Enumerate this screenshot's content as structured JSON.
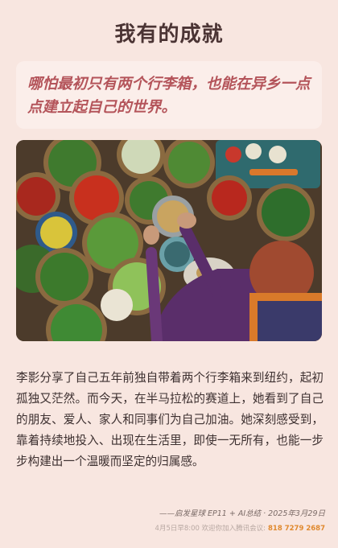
{
  "header": {
    "title": "我有的成就"
  },
  "quote": {
    "text": "哪怕最初只有两个行李箱，也能在异乡一点点建立起自己的世界。"
  },
  "photo": {
    "icon": "market-vegetables-photo"
  },
  "article": {
    "body": "李影分享了自己五年前独自带着两个行李箱来到纽约，起初孤独又茫然。而今天，在半马拉松的赛道上，她看到了自己的朋友、爱人、家人和同事们为自己加油。她深刻感受到，靠着持续地投入、出现在生活里，即使一无所有，也能一步步构建出一个温暖而坚定的归属感。"
  },
  "signature": {
    "text": "——启发星球 EP11 + AI总结 · 2025年3月29日"
  },
  "footer": {
    "notice": "4月5日早8:00 欢迎你加入腾讯会议:",
    "meeting_id": "818 7279 2687",
    "accent_color": "#e0892e"
  }
}
